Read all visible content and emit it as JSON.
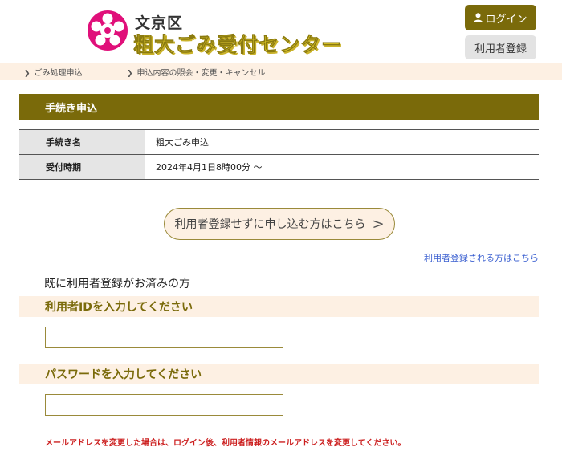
{
  "header": {
    "logo_icon": "bunkyo-ward-emblem-icon",
    "ward_name": "文京区",
    "center_name": "粗大ごみ受付センター",
    "login_label": "ログイン",
    "register_label": "利用者登録",
    "colors": {
      "brand": "#7a6a0a",
      "title": "#e8d12a",
      "emblem": "#e0107a"
    }
  },
  "nav": {
    "items": [
      {
        "label": "ごみ処理申込"
      },
      {
        "label": "申込内容の照会・変更・キャンセル"
      }
    ]
  },
  "section": {
    "title": "手続き申込"
  },
  "info_table": {
    "rows": [
      {
        "label": "手続き名",
        "value": "粗大ごみ申込"
      },
      {
        "label": "受付時期",
        "value": "2024年4月1日8時00分 〜"
      }
    ]
  },
  "guest_button": {
    "label": "利用者登録せずに申し込む方はこちら"
  },
  "register_link": {
    "label": "利用者登録される方はこちら"
  },
  "login_form": {
    "heading": "既に利用者登録がお済みの方",
    "user_id_label": "利用者IDを入力してください",
    "user_id_value": "",
    "password_label": "パスワードを入力してください",
    "password_value": "",
    "notice": "メールアドレスを変更した場合は、ログイン後、利用者情報のメールアドレスを変更してください。"
  }
}
